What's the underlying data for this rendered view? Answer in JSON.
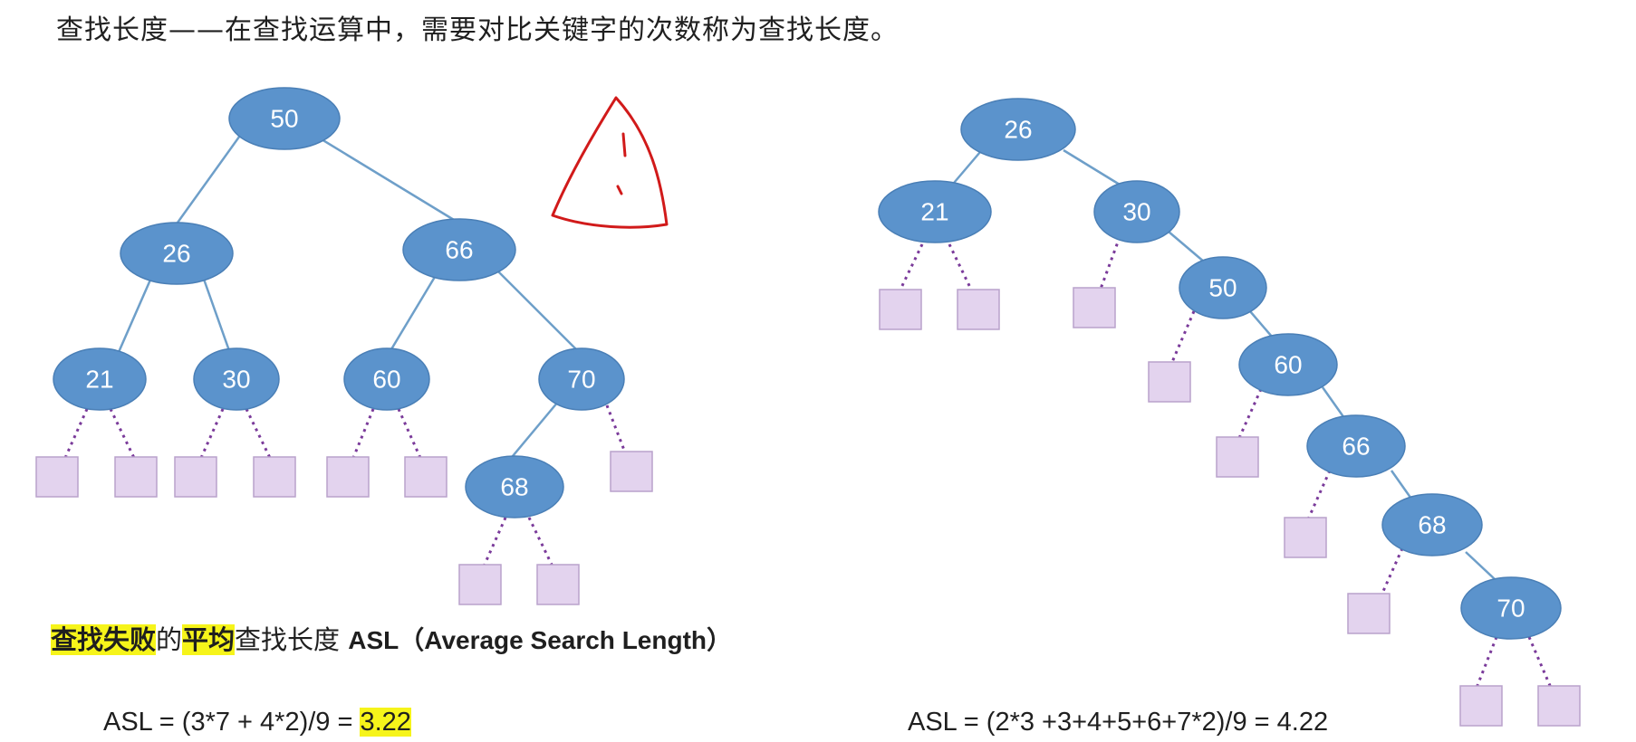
{
  "title_line": "查找长度——在查找运算中，需要对比关键字的次数称为查找长度。",
  "asl_heading": {
    "part1": "查找失败",
    "part2": "的",
    "part3": "平均",
    "part4": "查找长度 ",
    "part5": "ASL（Average Search Length）"
  },
  "formula_left": {
    "expr": "ASL = (3*7 + 4*2)/9 = ",
    "result": "3.22"
  },
  "formula_right": {
    "expr": "ASL = (2*3 +3+4+5+6+7*2)/9 = 4.22"
  },
  "left_tree": {
    "nodes": [
      "50",
      "26",
      "66",
      "21",
      "30",
      "60",
      "70",
      "68"
    ],
    "edges": [
      [
        "50",
        "26"
      ],
      [
        "50",
        "66"
      ],
      [
        "26",
        "21"
      ],
      [
        "26",
        "30"
      ],
      [
        "66",
        "60"
      ],
      [
        "66",
        "70"
      ],
      [
        "70",
        "68"
      ]
    ],
    "failure_leaves": 9
  },
  "right_tree": {
    "nodes": [
      "26",
      "21",
      "30",
      "50",
      "60",
      "66",
      "68",
      "70"
    ],
    "edges": [
      [
        "26",
        "21"
      ],
      [
        "26",
        "30"
      ],
      [
        "30",
        "50"
      ],
      [
        "50",
        "60"
      ],
      [
        "60",
        "66"
      ],
      [
        "66",
        "68"
      ],
      [
        "68",
        "70"
      ]
    ],
    "failure_leaves": 9
  },
  "colors": {
    "node_fill": "#5b93cc",
    "edge": "#6e9fc9",
    "leaf_fill": "#e3d3ee",
    "dotted_edge": "#7a3a9a",
    "highlight": "#f6f41a",
    "warning_mark": "#d11a1a"
  }
}
